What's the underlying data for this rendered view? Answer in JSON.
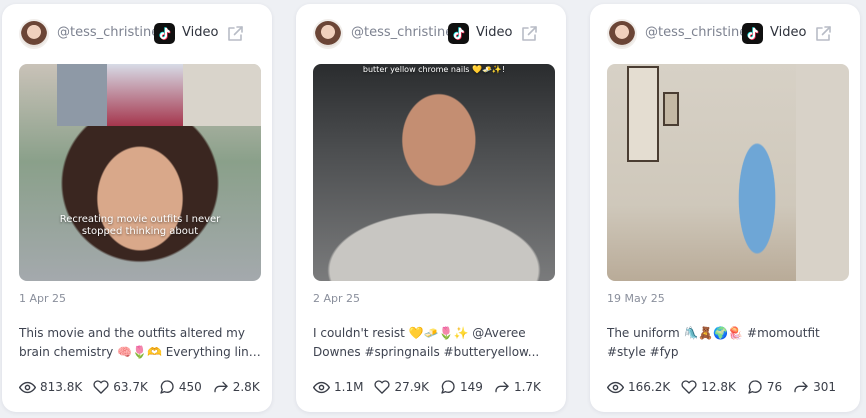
{
  "cards": [
    {
      "handle": "@tess_christine",
      "platform": "Video",
      "overlay": "Recreating movie outfits I never stopped thinking about",
      "date": "1 Apr 25",
      "desc_line1": "This movie and the outfits altered my",
      "desc_line2": "brain chemistry 🧠🌷🫶 Everything linke...",
      "views": "813.8K",
      "likes": "63.7K",
      "comments": "450",
      "shares": "2.8K"
    },
    {
      "handle": "@tess_christine",
      "platform": "Video",
      "overlay": "butter yellow chrome nails 💛🧈✨!",
      "date": "2 Apr 25",
      "desc_line1": "I couldn't resist 💛🧈🌷✨ @Averee",
      "desc_line2": "Downes #springnails #butteryellow...",
      "views": "1.1M",
      "likes": "27.9K",
      "comments": "149",
      "shares": "1.7K"
    },
    {
      "handle": "@tess_christine",
      "platform": "Video",
      "overlay": "",
      "date": "19 May 25",
      "desc_line1": "The uniform 🛝🧸🌍🪼 #momoutfit",
      "desc_line2": "#style #fyp",
      "views": "166.2K",
      "likes": "12.8K",
      "comments": "76",
      "shares": "301"
    }
  ],
  "colors": {
    "page_background": "#eef0f4",
    "card_background": "#ffffff",
    "muted_text": "#8a8f9c",
    "icon_stroke": "#3a3e48"
  },
  "icons": [
    "tiktok-icon",
    "external-link-icon",
    "eye-icon",
    "heart-icon",
    "comment-icon",
    "share-icon"
  ]
}
